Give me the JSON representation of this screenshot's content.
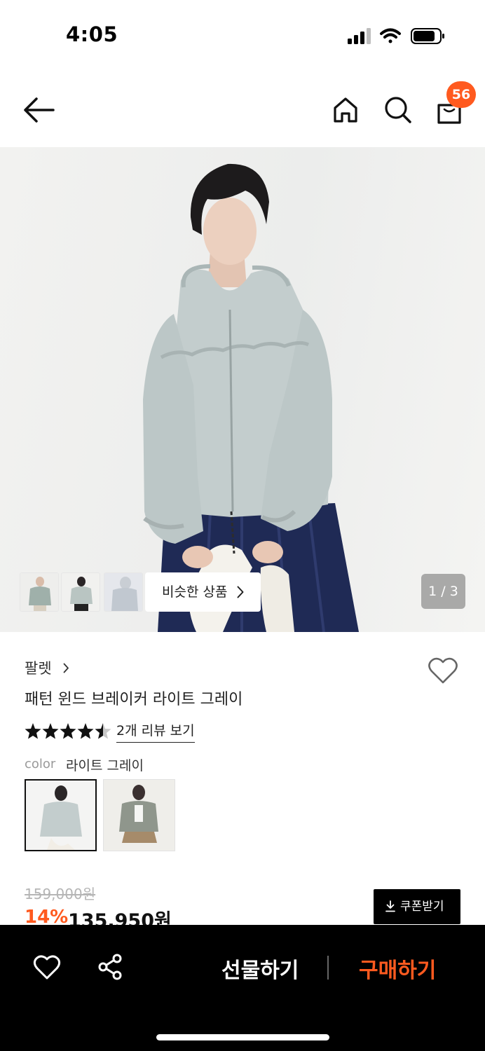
{
  "status_bar": {
    "time": "4:05",
    "icons": [
      "cellular-signal-icon",
      "wifi-icon",
      "battery-icon"
    ]
  },
  "header": {
    "cart_count": "56",
    "icons": [
      "back-arrow-icon",
      "home-icon",
      "search-icon",
      "shopping-bag-icon"
    ]
  },
  "gallery": {
    "similar_label": "비슷한 상품",
    "page_indicator": "1 / 3",
    "thumbnail_count": 3
  },
  "product": {
    "brand": "팔렛",
    "name": "패턴 윈드 브레이커 라이트 그레이",
    "rating": 4.5,
    "review_link": "2개 리뷰 보기",
    "color_label": "color",
    "color_value": "라이트 그레이"
  },
  "price": {
    "original": "159,000원",
    "discount": "14%",
    "sale": "135,950원",
    "coupon_label": "쿠폰받기"
  },
  "bottom_bar": {
    "gift_label": "선물하기",
    "buy_label": "구매하기"
  },
  "colors": {
    "accent": "#ff5a1f",
    "bottom_bar_bg": "#000000",
    "jacket": "#c3cdcd"
  }
}
